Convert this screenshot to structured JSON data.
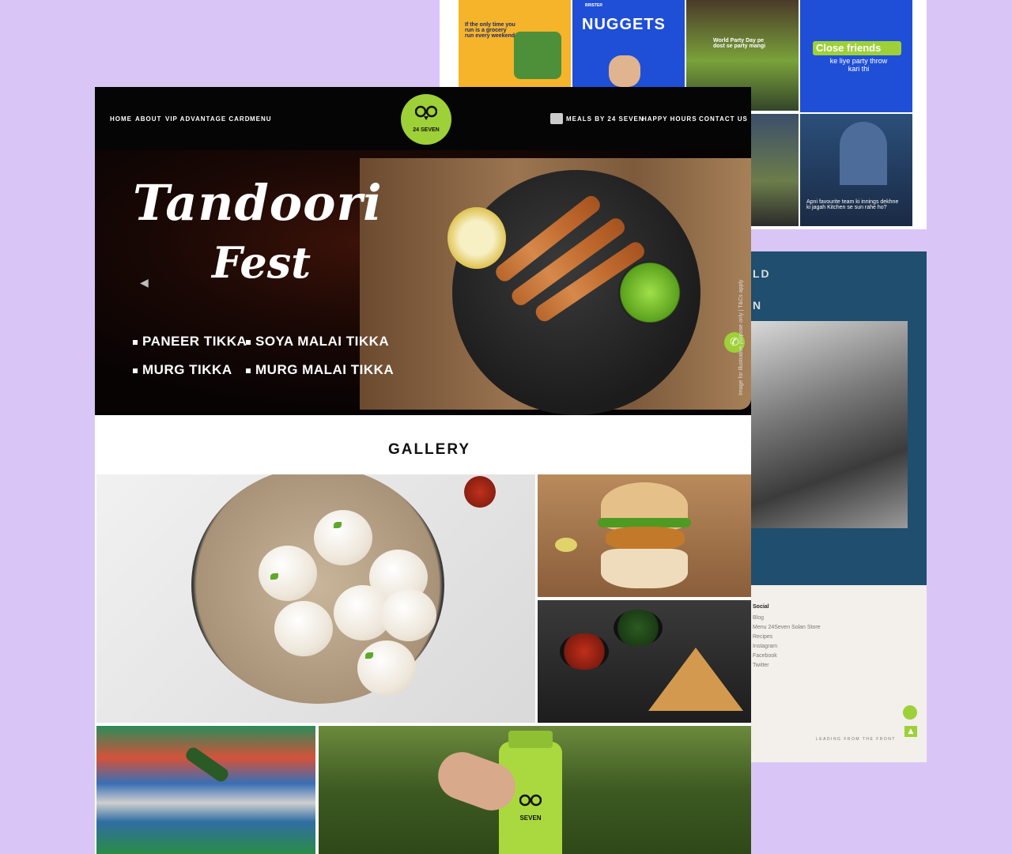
{
  "brand": {
    "name": "24 SEVEN",
    "accent": "#9ed038"
  },
  "nav": {
    "left": [
      "HOME",
      "ABOUT",
      "VIP ADVANTAGE CARD",
      "MENU"
    ],
    "right": [
      "MEALS BY 24 SEVEN",
      "HAPPY HOURS",
      "CONTACT US"
    ]
  },
  "hero": {
    "title_line1": "Tandoori",
    "title_line2": "Fest",
    "items": [
      "PANEER TIKKA",
      "SOYA MALAI TIKKA",
      "MURG TIKKA",
      "MURG MALAI TIKKA"
    ],
    "disclaimer": "Image for illustrative purpose only | T&Cs apply"
  },
  "gallery": {
    "title": "GALLERY",
    "bottle_label": "SEVEN"
  },
  "instagram": {
    "tile1": "If the only time you run is a grocery run every weekend",
    "tile2_label": "BRISTER",
    "tile2": "NUGGETS",
    "tile3": "World Party Day pe dost se party mangi",
    "tile4_title": "Close friends",
    "tile4": "ke liye party throw kari thi",
    "tile5": "Apni favourite team ki innings dekhne ki jagah Kitchen se sun rahe ho?"
  },
  "about_panel": {
    "heading1": "LD",
    "heading2": "N"
  },
  "footer": {
    "social_title": "Social",
    "links": [
      "Blog",
      "Menu 24Seven Solan Store",
      "Recipes",
      "Instagram",
      "Facebook",
      "Twitter"
    ],
    "tagline": "LEADING FROM THE FRONT"
  }
}
